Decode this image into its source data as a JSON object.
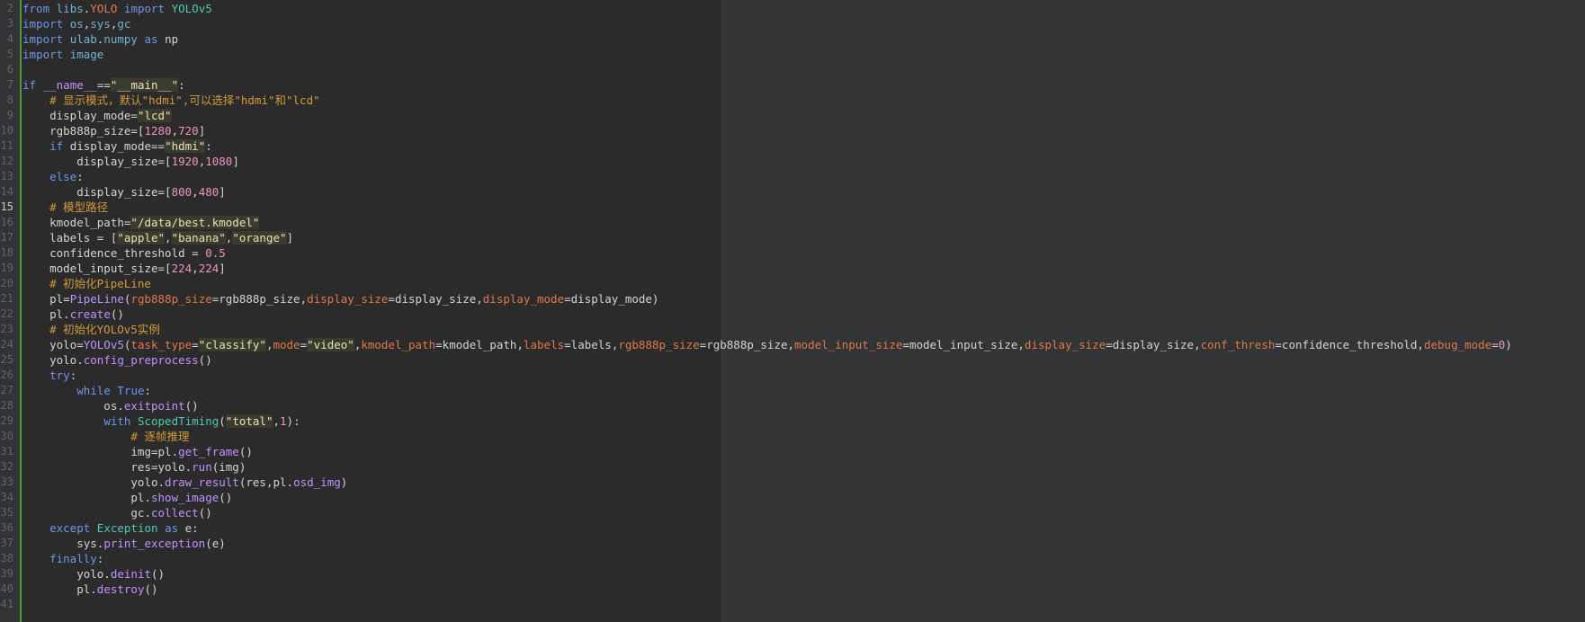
{
  "editor": {
    "current_line": 15,
    "lines": [
      {
        "n": 2,
        "t": [
          [
            "kw",
            "from"
          ],
          [
            "op",
            " "
          ],
          [
            "mod",
            "libs"
          ],
          [
            "op",
            "."
          ],
          [
            "param",
            "YOLO"
          ],
          [
            "op",
            " "
          ],
          [
            "kw",
            "import"
          ],
          [
            "op",
            " "
          ],
          [
            "cls",
            "YOLOv5"
          ]
        ]
      },
      {
        "n": 3,
        "t": [
          [
            "kw",
            "import"
          ],
          [
            "op",
            " "
          ],
          [
            "mod",
            "os"
          ],
          [
            "op",
            ","
          ],
          [
            "mod",
            "sys"
          ],
          [
            "op",
            ","
          ],
          [
            "mod",
            "gc"
          ]
        ]
      },
      {
        "n": 4,
        "t": [
          [
            "kw",
            "import"
          ],
          [
            "op",
            " "
          ],
          [
            "mod",
            "ulab"
          ],
          [
            "op",
            "."
          ],
          [
            "mod",
            "numpy"
          ],
          [
            "op",
            " "
          ],
          [
            "kw",
            "as"
          ],
          [
            "op",
            " np"
          ]
        ]
      },
      {
        "n": 5,
        "t": [
          [
            "kw",
            "import"
          ],
          [
            "op",
            " "
          ],
          [
            "mod",
            "image"
          ]
        ]
      },
      {
        "n": 6,
        "t": []
      },
      {
        "n": 7,
        "t": [
          [
            "kw",
            "if"
          ],
          [
            "op",
            " "
          ],
          [
            "dunder",
            "__name__"
          ],
          [
            "op",
            "=="
          ],
          [
            "str",
            "\"__main__\""
          ],
          [
            "op",
            ":"
          ]
        ]
      },
      {
        "n": 8,
        "t": [
          [
            "op",
            "    "
          ],
          [
            "cmt",
            "# 显示模式，默认\"hdmi\",可以选择\"hdmi\"和\"lcd\""
          ]
        ]
      },
      {
        "n": 9,
        "t": [
          [
            "op",
            "    display_mode="
          ],
          [
            "str",
            "\"lcd\""
          ]
        ]
      },
      {
        "n": 10,
        "t": [
          [
            "op",
            "    rgb888p_size=["
          ],
          [
            "num",
            "1280"
          ],
          [
            "op",
            ","
          ],
          [
            "num",
            "720"
          ],
          [
            "op",
            "]"
          ]
        ]
      },
      {
        "n": 11,
        "t": [
          [
            "op",
            "    "
          ],
          [
            "kw",
            "if"
          ],
          [
            "op",
            " display_mode=="
          ],
          [
            "str",
            "\"hdmi\""
          ],
          [
            "op",
            ":"
          ]
        ]
      },
      {
        "n": 12,
        "t": [
          [
            "op",
            "        display_size=["
          ],
          [
            "num",
            "1920"
          ],
          [
            "op",
            ","
          ],
          [
            "num",
            "1080"
          ],
          [
            "op",
            "]"
          ]
        ]
      },
      {
        "n": 13,
        "t": [
          [
            "op",
            "    "
          ],
          [
            "kw",
            "else"
          ],
          [
            "op",
            ":"
          ]
        ]
      },
      {
        "n": 14,
        "t": [
          [
            "op",
            "        display_size=["
          ],
          [
            "num",
            "800"
          ],
          [
            "op",
            ","
          ],
          [
            "num",
            "480"
          ],
          [
            "op",
            "]"
          ]
        ]
      },
      {
        "n": 15,
        "t": [
          [
            "op",
            "    "
          ],
          [
            "cmt",
            "# 模型路径"
          ]
        ]
      },
      {
        "n": 16,
        "t": [
          [
            "op",
            "    kmodel_path="
          ],
          [
            "str",
            "\"/data/best.kmodel\""
          ]
        ]
      },
      {
        "n": 17,
        "t": [
          [
            "op",
            "    labels = ["
          ],
          [
            "str",
            "\"apple\""
          ],
          [
            "op",
            ","
          ],
          [
            "str",
            "\"banana\""
          ],
          [
            "op",
            ","
          ],
          [
            "str",
            "\"orange\""
          ],
          [
            "op",
            "]"
          ]
        ]
      },
      {
        "n": 18,
        "t": [
          [
            "op",
            "    confidence_threshold = "
          ],
          [
            "num",
            "0.5"
          ]
        ]
      },
      {
        "n": 19,
        "t": [
          [
            "op",
            "    model_input_size=["
          ],
          [
            "num",
            "224"
          ],
          [
            "op",
            ","
          ],
          [
            "num",
            "224"
          ],
          [
            "op",
            "]"
          ]
        ]
      },
      {
        "n": 20,
        "t": [
          [
            "op",
            "    "
          ],
          [
            "cmt",
            "# 初始化PipeLine"
          ]
        ]
      },
      {
        "n": 21,
        "t": [
          [
            "op",
            "    pl="
          ],
          [
            "fn",
            "PipeLine"
          ],
          [
            "op",
            "("
          ],
          [
            "param",
            "rgb888p_size"
          ],
          [
            "op",
            "=rgb888p_size,"
          ],
          [
            "param",
            "display_size"
          ],
          [
            "op",
            "=display_size,"
          ],
          [
            "param",
            "display_mode"
          ],
          [
            "op",
            "=display_mode)"
          ]
        ]
      },
      {
        "n": 22,
        "t": [
          [
            "op",
            "    pl."
          ],
          [
            "fn",
            "create"
          ],
          [
            "op",
            "()"
          ]
        ]
      },
      {
        "n": 23,
        "t": [
          [
            "op",
            "    "
          ],
          [
            "cmt",
            "# 初始化YOLOv5实例"
          ]
        ]
      },
      {
        "n": 24,
        "t": [
          [
            "op",
            "    yolo="
          ],
          [
            "fn",
            "YOLOv5"
          ],
          [
            "op",
            "("
          ],
          [
            "param",
            "task_type"
          ],
          [
            "op",
            "="
          ],
          [
            "str",
            "\"classify\""
          ],
          [
            "op",
            ","
          ],
          [
            "param",
            "mode"
          ],
          [
            "op",
            "="
          ],
          [
            "str",
            "\"video\""
          ],
          [
            "op",
            ","
          ],
          [
            "param",
            "kmodel_path"
          ],
          [
            "op",
            "=kmodel_path,"
          ],
          [
            "param",
            "labels"
          ],
          [
            "op",
            "=labels,"
          ],
          [
            "param",
            "rgb888p_size"
          ],
          [
            "op",
            "=rgb888p_size,"
          ],
          [
            "param",
            "model_input_size"
          ],
          [
            "op",
            "=model_input_size,"
          ],
          [
            "param",
            "display_size"
          ],
          [
            "op",
            "=display_size,"
          ],
          [
            "param",
            "conf_thresh"
          ],
          [
            "op",
            "=confidence_threshold,"
          ],
          [
            "param",
            "debug_mode"
          ],
          [
            "op",
            "="
          ],
          [
            "num",
            "0"
          ],
          [
            "op",
            ")"
          ]
        ]
      },
      {
        "n": 25,
        "t": [
          [
            "op",
            "    yolo."
          ],
          [
            "fn",
            "config_preprocess"
          ],
          [
            "op",
            "()"
          ]
        ]
      },
      {
        "n": 26,
        "t": [
          [
            "op",
            "    "
          ],
          [
            "kw",
            "try"
          ],
          [
            "op",
            ":"
          ]
        ]
      },
      {
        "n": 27,
        "t": [
          [
            "op",
            "        "
          ],
          [
            "kw",
            "while"
          ],
          [
            "op",
            " "
          ],
          [
            "kw",
            "True"
          ],
          [
            "op",
            ":"
          ]
        ]
      },
      {
        "n": 28,
        "t": [
          [
            "op",
            "            os."
          ],
          [
            "fn",
            "exitpoint"
          ],
          [
            "op",
            "()"
          ]
        ]
      },
      {
        "n": 29,
        "t": [
          [
            "op",
            "            "
          ],
          [
            "kw",
            "with"
          ],
          [
            "op",
            " "
          ],
          [
            "cls",
            "ScopedTiming"
          ],
          [
            "op",
            "("
          ],
          [
            "str",
            "\"total\""
          ],
          [
            "op",
            ","
          ],
          [
            "num",
            "1"
          ],
          [
            "op",
            "):"
          ]
        ]
      },
      {
        "n": 30,
        "t": [
          [
            "op",
            "                "
          ],
          [
            "cmt",
            "# 逐帧推理"
          ]
        ]
      },
      {
        "n": 31,
        "t": [
          [
            "op",
            "                img=pl."
          ],
          [
            "fn",
            "get_frame"
          ],
          [
            "op",
            "()"
          ]
        ]
      },
      {
        "n": 32,
        "t": [
          [
            "op",
            "                res=yolo."
          ],
          [
            "fn",
            "run"
          ],
          [
            "op",
            "(img)"
          ]
        ]
      },
      {
        "n": 33,
        "t": [
          [
            "op",
            "                yolo."
          ],
          [
            "fn",
            "draw_result"
          ],
          [
            "op",
            "(res,pl."
          ],
          [
            "fn",
            "osd_img"
          ],
          [
            "op",
            ")"
          ]
        ]
      },
      {
        "n": 34,
        "t": [
          [
            "op",
            "                pl."
          ],
          [
            "fn",
            "show_image"
          ],
          [
            "op",
            "()"
          ]
        ]
      },
      {
        "n": 35,
        "t": [
          [
            "op",
            "                gc."
          ],
          [
            "fn",
            "collect"
          ],
          [
            "op",
            "()"
          ]
        ]
      },
      {
        "n": 36,
        "t": [
          [
            "op",
            "    "
          ],
          [
            "kw",
            "except"
          ],
          [
            "op",
            " "
          ],
          [
            "cls",
            "Exception"
          ],
          [
            "op",
            " "
          ],
          [
            "kw",
            "as"
          ],
          [
            "op",
            " e:"
          ]
        ]
      },
      {
        "n": 37,
        "t": [
          [
            "op",
            "        sys."
          ],
          [
            "fn",
            "print_exception"
          ],
          [
            "op",
            "(e)"
          ]
        ]
      },
      {
        "n": 38,
        "t": [
          [
            "op",
            "    "
          ],
          [
            "kw",
            "finally"
          ],
          [
            "op",
            ":"
          ]
        ]
      },
      {
        "n": 39,
        "t": [
          [
            "op",
            "        yolo."
          ],
          [
            "fn",
            "deinit"
          ],
          [
            "op",
            "()"
          ]
        ]
      },
      {
        "n": 40,
        "t": [
          [
            "op",
            "        pl."
          ],
          [
            "fn",
            "destroy"
          ],
          [
            "op",
            "()"
          ]
        ]
      },
      {
        "n": 41,
        "t": []
      }
    ]
  }
}
